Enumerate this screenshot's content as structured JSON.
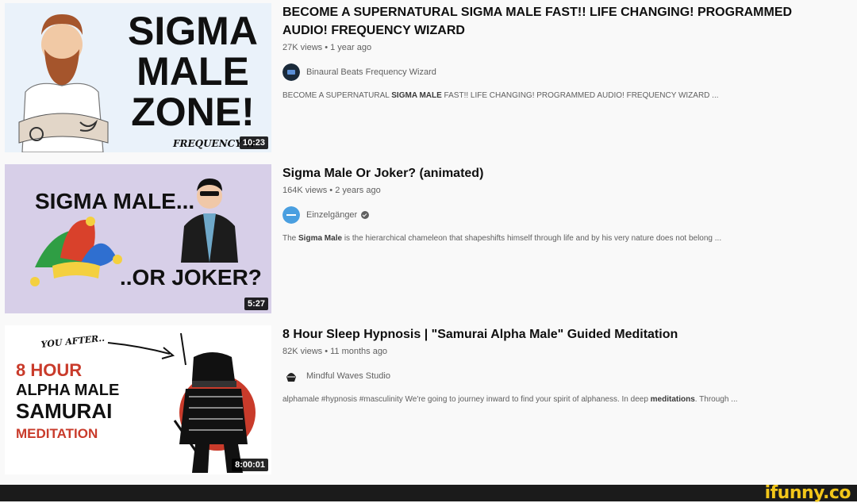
{
  "results": [
    {
      "title": "BECOME A SUPERNATURAL SIGMA MALE FAST!! LIFE CHANGING! PROGRAMMED AUDIO! FREQUENCY WIZARD",
      "stats": "27K views • 1 year ago",
      "channel": "Binaural Beats Frequency Wizard",
      "verified": false,
      "duration": "10:23",
      "desc_pre": "BECOME A SUPERNATURAL ",
      "desc_bold": "SIGMA MALE",
      "desc_post": " FAST!! LIFE CHANGING! PROGRAMMED AUDIO! FREQUENCY WIZARD ...",
      "thumb_text": {
        "line1": "SIGMA",
        "line2": "MALE",
        "line3": "ZONE!",
        "line4": "FREQUENCY W"
      }
    },
    {
      "title": "Sigma Male Or Joker? (animated)",
      "stats": "164K views • 2 years ago",
      "channel": "Einzelgänger",
      "verified": true,
      "duration": "5:27",
      "desc_pre": "The ",
      "desc_bold": "Sigma Male",
      "desc_post": " is the hierarchical chameleon that shapeshifts himself through life and by his very nature does not belong ...",
      "thumb_text": {
        "line1": "SIGMA MALE...",
        "line2": "..OR JOKER?"
      }
    },
    {
      "title": "8 Hour Sleep Hypnosis | \"Samurai Alpha Male\" Guided Meditation",
      "stats": "82K views • 11 months ago",
      "channel": "Mindful Waves Studio",
      "verified": false,
      "duration": "8:00:01",
      "desc_pre": "alphamale #hypnosis #masculinity We're going to journey inward to find your spirit of alphaness. In deep ",
      "desc_bold": "meditations",
      "desc_post": ". Through ...",
      "thumb_text": {
        "line1": "YOU AFTER..",
        "line2": "8 HOUR",
        "line3": "ALPHA MALE",
        "line4": "SAMURAI",
        "line5": "MEDITATION"
      }
    }
  ],
  "watermark": "ifunny.co",
  "colors": {
    "background": "#f9f9f9",
    "title": "#0f0f0f",
    "secondary": "#606060",
    "thumb1_bg": "#eaf2fa",
    "thumb2_bg": "#d7cfe8",
    "thumb3_bg": "#ffffff",
    "samurai_red": "#c93b2b",
    "watermark": "#f2c61a"
  }
}
